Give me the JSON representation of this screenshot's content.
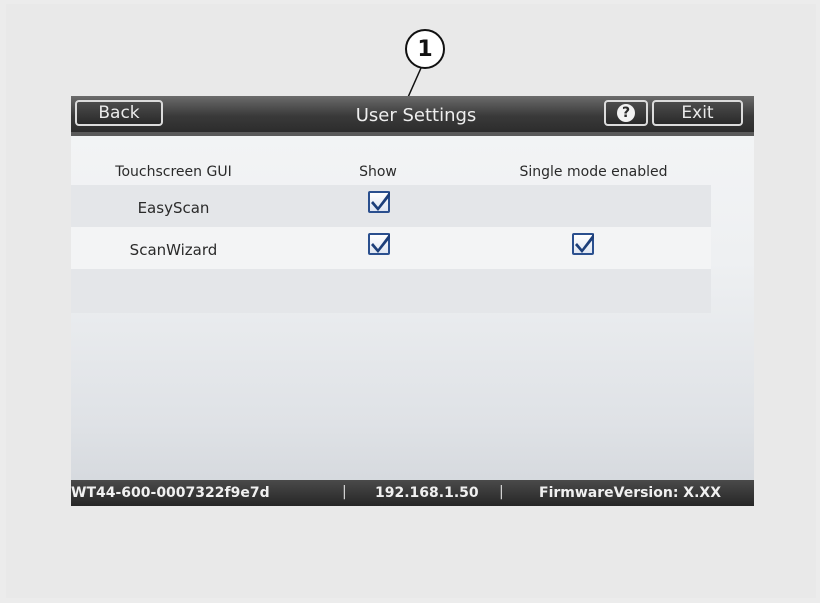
{
  "callout": {
    "number": "1"
  },
  "header": {
    "back_label": "Back",
    "title": "User Settings",
    "help_label": "?",
    "exit_label": "Exit"
  },
  "table": {
    "columns": [
      "Touchscreen GUI",
      "Show",
      "Single mode enabled"
    ],
    "rows": [
      {
        "label": "EasyScan",
        "show": true,
        "single_mode": false
      },
      {
        "label": "ScanWizard",
        "show": true,
        "single_mode": true
      }
    ]
  },
  "status": {
    "device_id": "WT44-600-0007322f9e7d",
    "separator": "|",
    "ip": "192.168.1.50",
    "firmware": "FirmwareVersion: X.XX"
  },
  "colors": {
    "checkbox_border": "#2a4f8e",
    "checkmark": "#1d3f7a",
    "titlebar": "#3a3a3a"
  },
  "icons": {
    "help": "question-circle-icon",
    "checkbox": "checkbox-checked-icon"
  }
}
